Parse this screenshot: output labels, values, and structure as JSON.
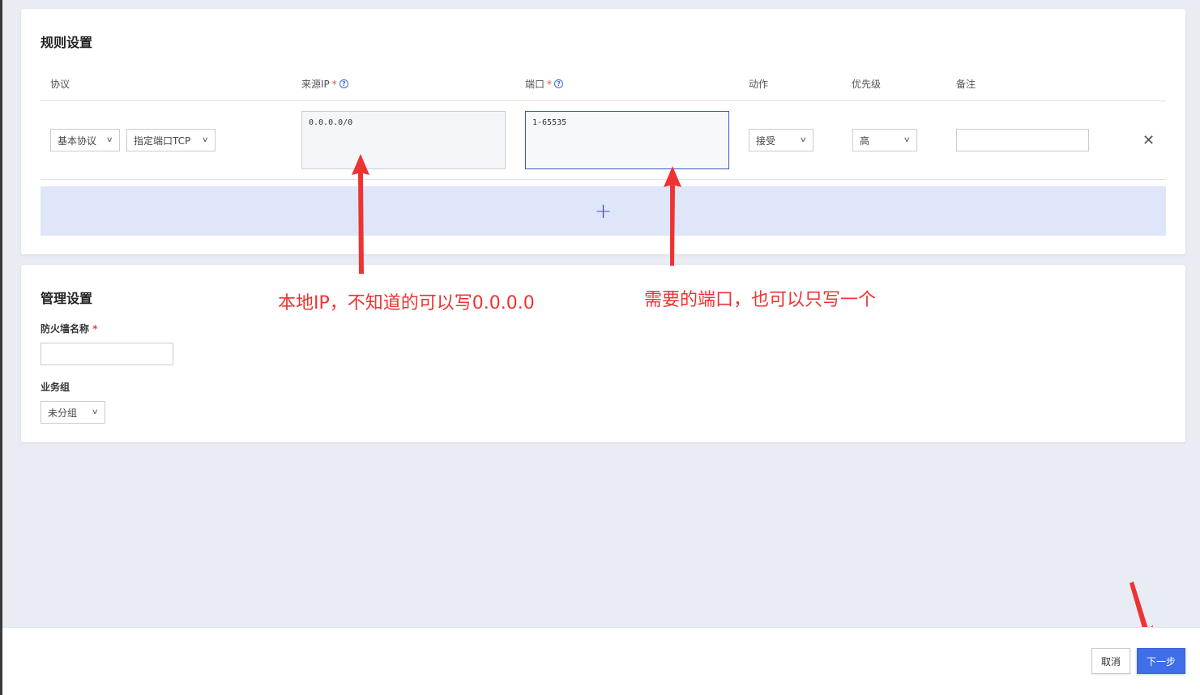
{
  "rules": {
    "title": "规则设置",
    "headers": {
      "protocol": "协议",
      "source_ip": "来源IP",
      "port": "端口",
      "action": "动作",
      "priority": "优先级",
      "remark": "备注"
    },
    "required_mark": "*",
    "help_icon": "?",
    "row": {
      "protocol_type": "基本协议",
      "protocol_port": "指定端口TCP",
      "source_ip_value": "0.0.0.0/0",
      "port_value": "1-65535",
      "action": "接受",
      "priority": "高",
      "remark": ""
    },
    "delete_icon": "✕",
    "add_icon": "+"
  },
  "management": {
    "title": "管理设置",
    "firewall_name_label": "防火墙名称",
    "firewall_name_value": "",
    "business_group_label": "业务组",
    "business_group_value": "未分组"
  },
  "annotations": {
    "ip_note": "本地IP，不知道的可以写0.0.0.0",
    "port_note": "需要的端口，也可以只写一个",
    "color": "#ee3333"
  },
  "footer": {
    "cancel_label": "取消",
    "next_label": "下一步",
    "accent": "#3e6ee8"
  }
}
